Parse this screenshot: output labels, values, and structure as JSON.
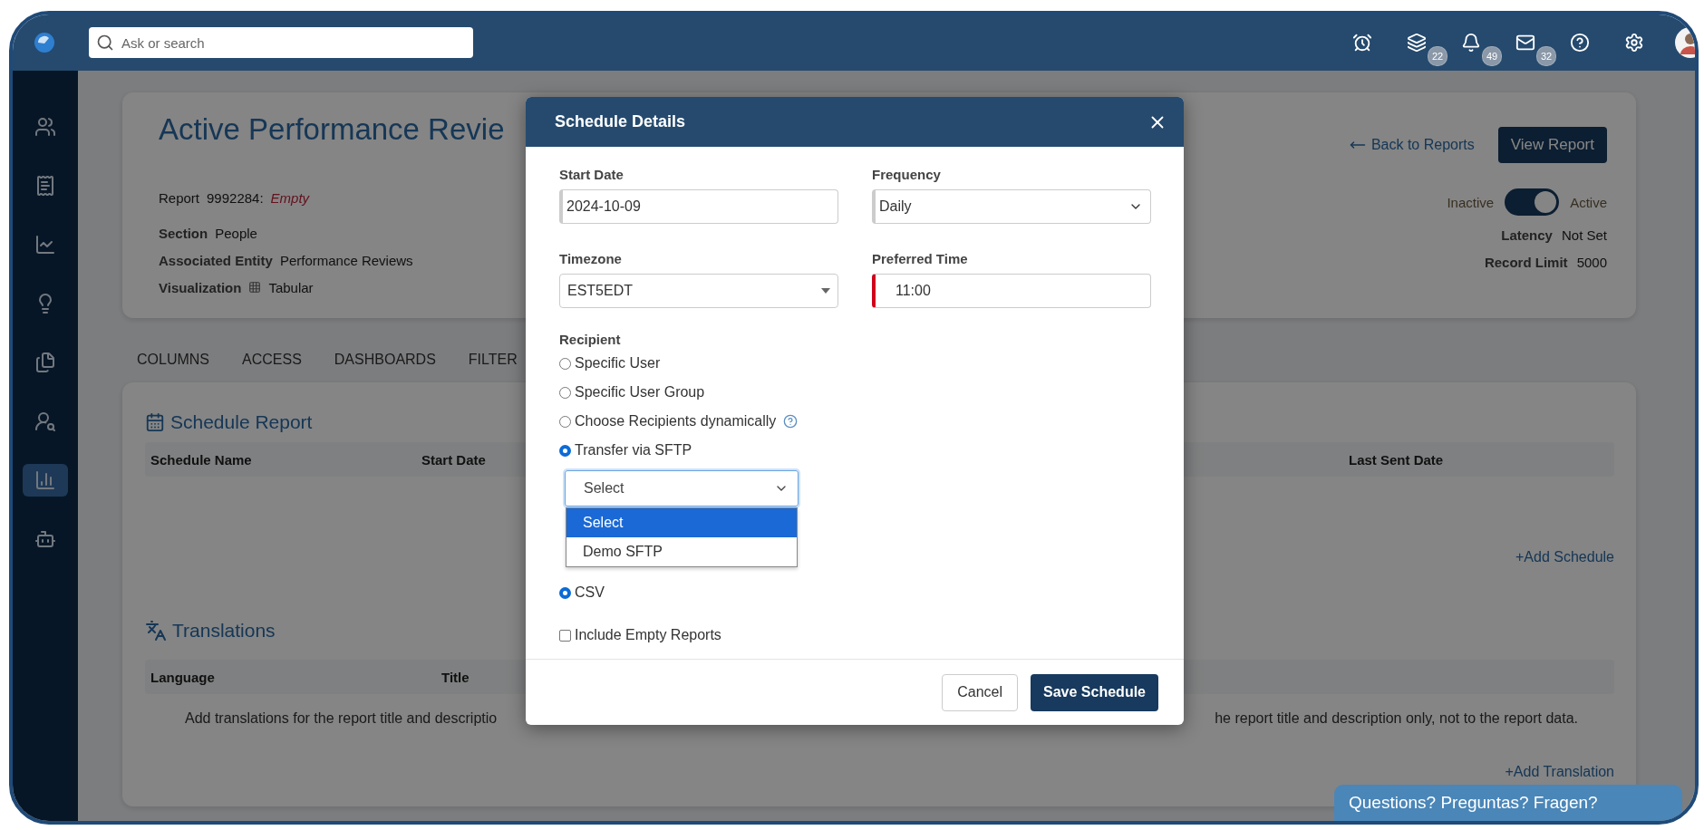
{
  "topbar": {
    "search": {
      "placeholder": "Ask or search"
    },
    "icons": [
      {
        "kind": "alarm"
      },
      {
        "kind": "layers",
        "badge": "22"
      },
      {
        "kind": "bell",
        "badge": "49"
      },
      {
        "kind": "mail",
        "badge": "32"
      },
      {
        "kind": "help"
      },
      {
        "kind": "settings"
      }
    ]
  },
  "sidebar": {
    "items": [
      {
        "selected": false
      },
      {
        "selected": false
      },
      {
        "selected": false
      },
      {
        "selected": false
      },
      {
        "selected": false
      },
      {
        "selected": false
      },
      {
        "selected": true
      },
      {
        "selected": false
      }
    ]
  },
  "report": {
    "title": "Active Performance Revie",
    "report_label": "Report",
    "report_id": "9992284:",
    "report_state": "Empty",
    "details": [
      {
        "label": "Section",
        "value": "People"
      },
      {
        "label": "Associated Entity",
        "value": "Performance Reviews"
      },
      {
        "label": "Visualization",
        "value": "Tabular",
        "kind": "table"
      }
    ],
    "back_link": "Back to Reports",
    "view_button": "View Report",
    "status": {
      "off_label": "Inactive",
      "on_label": "Active",
      "on": true
    },
    "meta": [
      {
        "label": "Latency",
        "value": "Not Set"
      },
      {
        "label": "Record Limit",
        "value": "5000"
      }
    ]
  },
  "tabs": [
    {
      "label": "COLUMNS"
    },
    {
      "label": "ACCESS"
    },
    {
      "label": "DASHBOARDS"
    },
    {
      "label": "FILTER"
    }
  ],
  "schedule": {
    "title": "Schedule Report",
    "columns": [
      "Schedule Name",
      "Start Date",
      "Last Sent Date"
    ],
    "add_link": "+Add Schedule"
  },
  "translations": {
    "title": "Translations",
    "columns": [
      "Language",
      "Title"
    ],
    "note_start": "Add translations for the report title and descriptio",
    "note_end": "he report title and description only, not to the report data.",
    "add_link": "+Add Translation"
  },
  "modal": {
    "title": "Schedule Details",
    "fields": [
      {
        "label": "Start Date",
        "value": "2024-10-09",
        "kind": "text",
        "readonly": true,
        "invalid": false
      },
      {
        "label": "Frequency",
        "value": "Daily",
        "kind": "select",
        "readonly": true,
        "invalid": false
      },
      {
        "label": "Timezone",
        "value": "EST5EDT",
        "kind": "combo",
        "readonly": false,
        "invalid": false
      },
      {
        "label": "Preferred Time",
        "value": "11:00",
        "kind": "text",
        "readonly": false,
        "invalid": true
      }
    ],
    "recipient": {
      "label": "Recipient",
      "options": [
        {
          "label": "Specific User",
          "selected": false
        },
        {
          "label": "Specific User Group",
          "selected": false
        },
        {
          "label": "Choose Recipients dynamically",
          "selected": false,
          "help": true
        },
        {
          "label": "Transfer via SFTP",
          "selected": true
        }
      ]
    },
    "sftp": {
      "value": "Select",
      "expanded": true,
      "options": [
        {
          "label": "Select",
          "selected": true
        },
        {
          "label": "Demo SFTP",
          "selected": false
        }
      ]
    },
    "format": {
      "options": [
        {
          "label": "CSV",
          "selected": true
        }
      ]
    },
    "include_empty": {
      "label": "Include Empty Reports",
      "checked": false
    },
    "cancel": "Cancel",
    "save": "Save Schedule"
  },
  "help_widget": "Questions? Preguntas? Fragen?"
}
